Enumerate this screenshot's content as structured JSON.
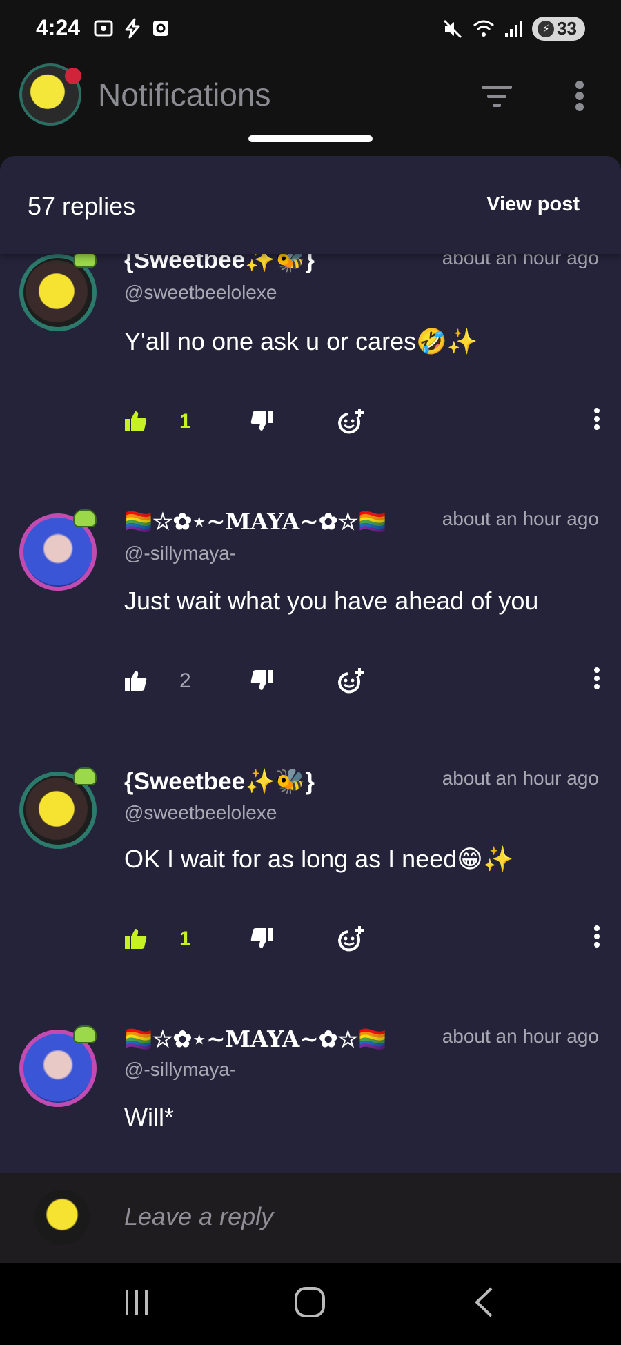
{
  "status_bar": {
    "time": "4:24",
    "battery": "33"
  },
  "header": {
    "title": "Notifications"
  },
  "sheet": {
    "reply_count": "57 replies",
    "view_post": "View post"
  },
  "comments": [
    {
      "name": "{Sweetbee✨🐝}",
      "handle": "@sweetbeelolexe",
      "time": "about an hour ago",
      "text": "Y'all no one ask u or cares🤣✨",
      "likes": "1",
      "liked": true
    },
    {
      "name": "🏳️‍🌈☆✿⋆~MAYA~✿☆🏳️‍🌈",
      "handle": "@-sillymaya-",
      "time": "about an hour ago",
      "text": "Just wait what you have ahead of you",
      "likes": "2",
      "liked": false
    },
    {
      "name": "{Sweetbee✨🐝}",
      "handle": "@sweetbeelolexe",
      "time": "about an hour ago",
      "text": "OK I wait for as long as I need😁✨",
      "likes": "1",
      "liked": true
    },
    {
      "name": "🏳️‍🌈☆✿⋆~MAYA~✿☆🏳️‍🌈",
      "handle": "@-sillymaya-",
      "time": "about an hour ago",
      "text": "Will*"
    }
  ],
  "reply_bar": {
    "placeholder": "Leave a reply"
  },
  "colors": {
    "liked": "#c6f124",
    "sheet_bg": "#25233a",
    "muted": "#a9a8b3"
  }
}
